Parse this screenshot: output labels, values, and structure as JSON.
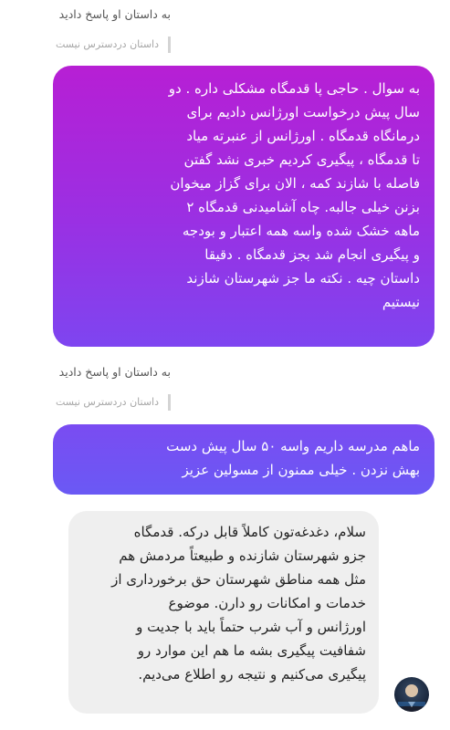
{
  "thread": {
    "reply_label_1": "به داستان او پاسخ دادید",
    "story_unavailable_1": "داستان دردسترس نیست",
    "message_1": [
      "به سوال . حاجی پا قدمگاه مشکلی داره . دو",
      "سال پیش درخواست اورژانس دادیم برای",
      "درمانگاه قدمگاه . اورژانس از عنبرته میاد",
      "تا قدمگاه ، پیگیری کردیم خبری نشد گفتن",
      "فاصله با شازند کمه ، الان برای گزاز میخوان",
      "بزنن خیلی جالبه. چاه آشامیدنی قدمگاه ۲",
      "ماهه خشک شده واسه همه اعتبار و بودجه",
      "و پیگیری انجام شد بجز قدمگاه . دقیقا",
      "داستان چیه . نکته ما جز شهرستان شازند",
      "نیستیم"
    ],
    "reply_label_2": "به داستان او پاسخ دادید",
    "story_unavailable_2": "داستان دردسترس نیست",
    "message_2": [
      "ماهم مدرسه داریم واسه ۵۰ سال پیش دست",
      "بهش نزدن . خیلی ممنون از مسولین عزیز"
    ],
    "reply_message": [
      "سلام، دغدغه‌تون کاملاً قابل درکه. قدمگاه",
      "جزو شهرستان شازنده و طبیعتاً مردمش هم",
      "مثل همه مناطق شهرستان حق برخورداری از",
      "خدمات و امکانات رو دارن. موضوع",
      "اورژانس و آب شرب حتماً باید با جدیت و",
      "شفافیت پیگیری بشه  ما هم این موارد رو",
      "پیگیری می‌کنیم و نتیجه رو اطلاع می‌دیم."
    ]
  },
  "colors": {
    "bubble_1_top": "#b71fd4",
    "bubble_1_bottom": "#7e45f0",
    "bubble_2": "#6a59f4",
    "reply_bubble": "#efefef"
  }
}
